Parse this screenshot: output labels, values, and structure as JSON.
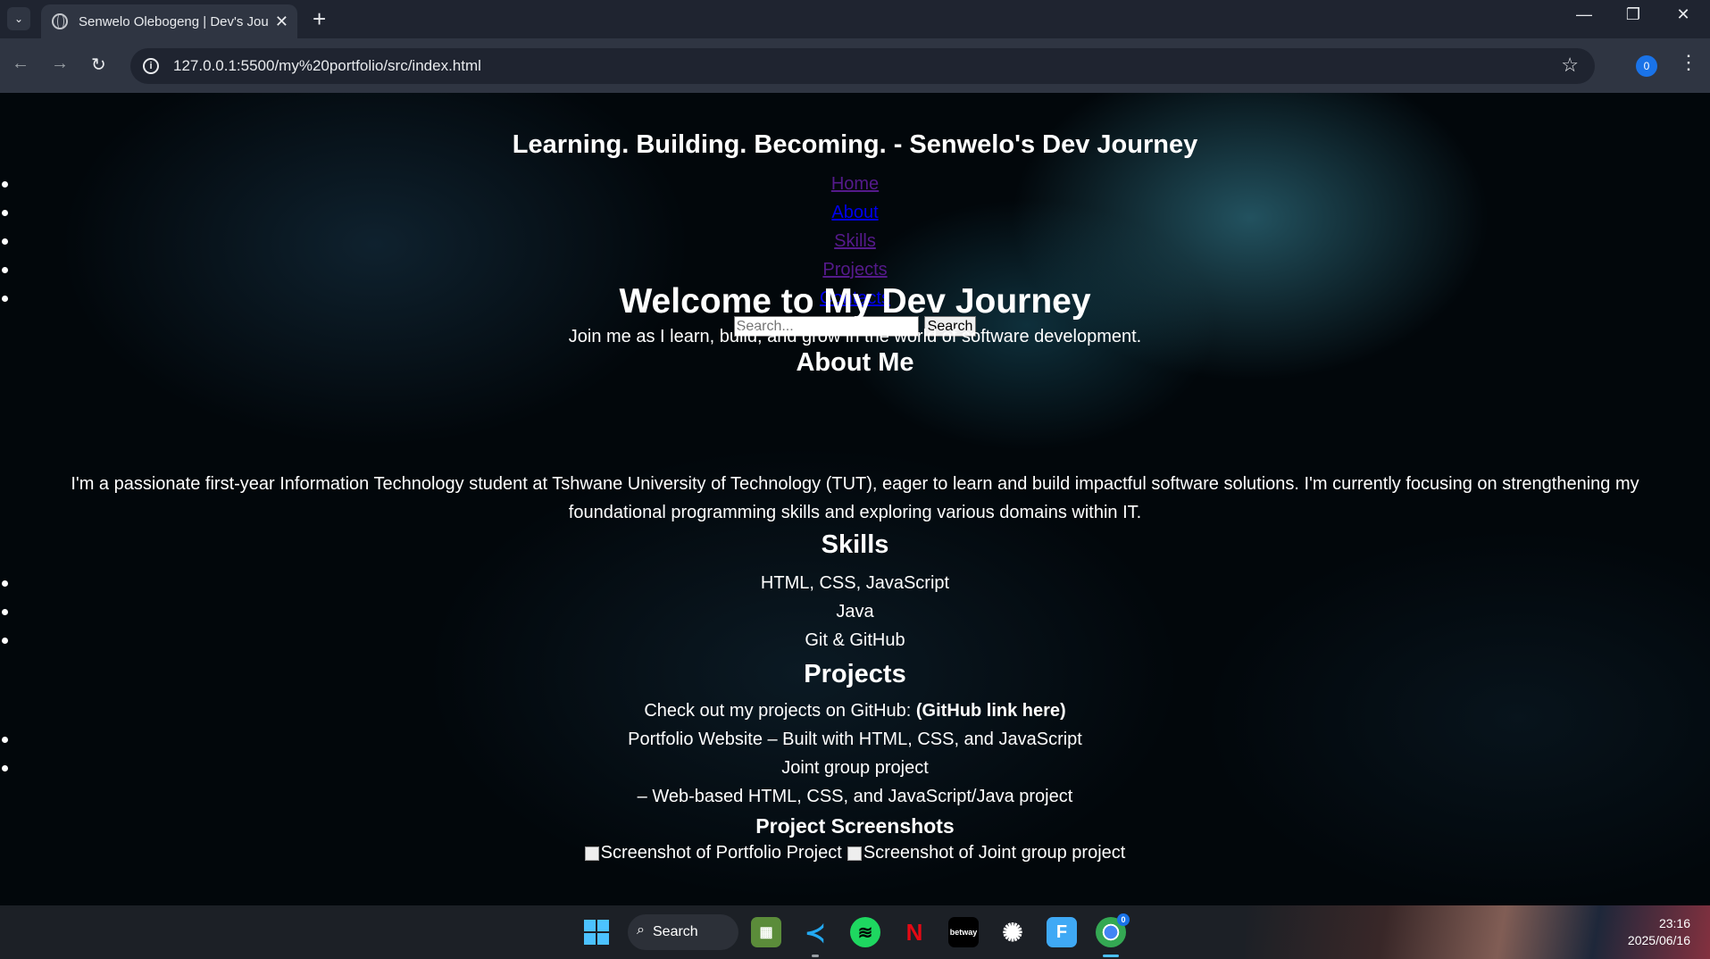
{
  "browser": {
    "tab_title": "Senwelo Olebogeng | Dev's Journey",
    "url": "127.0.0.1:5500/my%20portfolio/src/index.html",
    "profile_badge": "0",
    "new_tab": "+",
    "close": "✕"
  },
  "page": {
    "site_title": "Learning. Building. Becoming. - Senwelo's Dev Journey",
    "nav": [
      {
        "label": "Home",
        "visited": true
      },
      {
        "label": "About",
        "visited": false
      },
      {
        "label": "Skills",
        "visited": true
      },
      {
        "label": "Projects",
        "visited": true
      },
      {
        "label": "Contacts",
        "visited": false
      }
    ],
    "search": {
      "placeholder": "Search...",
      "button": "Search"
    },
    "hero": {
      "heading": "Welcome to My Dev Journey",
      "subtitle": "Join me as I learn, build, and grow in the world of software development."
    },
    "about": {
      "heading": "About Me",
      "text": "I'm a passionate first-year Information Technology student at Tshwane University of Technology (TUT), eager to learn and build impactful software solutions. I'm currently focusing on strengthening my foundational programming skills and exploring various domains within IT."
    },
    "skills": {
      "heading": "Skills",
      "items": [
        "HTML, CSS, JavaScript",
        "Java",
        "Git & GitHub"
      ]
    },
    "projects": {
      "heading": "Projects",
      "intro": "Check out my projects on GitHub: ",
      "github_link": "(GitHub link here)",
      "items": [
        "Portfolio Website – Built with HTML, CSS, and JavaScript",
        "Joint group project"
      ],
      "continuation": "– Web-based HTML, CSS, and JavaScript/Java project",
      "screenshots_heading": "Project Screenshots",
      "screenshot_alts": [
        "Screenshot of Portfolio Project",
        "Screenshot of Joint group project"
      ]
    }
  },
  "taskbar": {
    "search_label": "Search",
    "time": "23:16",
    "date": "2025/06/16",
    "apps": [
      "file-explorer-icon",
      "vscode-icon",
      "spotify-icon",
      "netflix-icon",
      "betway-icon",
      "chatgpt-icon",
      "files-icon",
      "chrome-icon"
    ],
    "app_glyphs": {
      "vscode": "≺",
      "spotify": "≋",
      "netflix": "N",
      "betway": "betway",
      "chatgpt": "✺",
      "files": "F"
    },
    "chrome_badge": "0"
  },
  "colors": {
    "link_visited": "#551a8b",
    "link_unvisited": "#0000ee",
    "chrome_bg": "#1f2430",
    "taskbar_bg": "#1c2026",
    "windows_accent": "#4cc2ff"
  }
}
